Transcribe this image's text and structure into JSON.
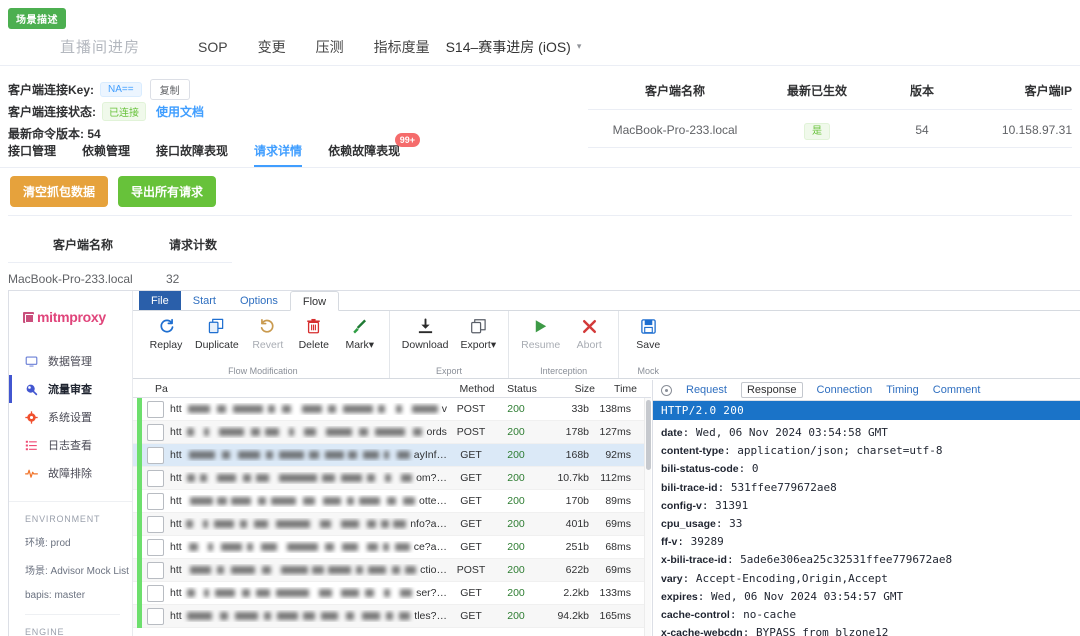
{
  "scenario_badge": "场景描述",
  "header": {
    "title": "直播间进房",
    "nav": [
      "SOP",
      "变更",
      "压测",
      "指标度量"
    ],
    "selector": "S14–赛事进房 (iOS)"
  },
  "client_info": {
    "key_label": "客户端连接Key:",
    "key_value": "NA==",
    "copy_button": "复制",
    "status_label": "客户端连接状态:",
    "status_value": "已连接",
    "doc_link": "使用文档",
    "version_label": "最新命令版本: 54"
  },
  "subtabs": [
    {
      "label": "接口管理",
      "active": false
    },
    {
      "label": "依赖管理",
      "active": false
    },
    {
      "label": "接口故障表现",
      "active": false
    },
    {
      "label": "请求详情",
      "active": true
    },
    {
      "label": "依赖故障表现",
      "active": false,
      "badge": "99+"
    }
  ],
  "actions": {
    "clear": "清空抓包数据",
    "export_all": "导出所有请求"
  },
  "left_table": {
    "headers": [
      "客户端名称",
      "请求计数"
    ],
    "rows": [
      [
        "MacBook-Pro-233.local",
        "32"
      ]
    ]
  },
  "right_table": {
    "headers": [
      "客户端名称",
      "最新已生效",
      "版本",
      "客户端IP"
    ],
    "rows": [
      [
        "MacBook-Pro-233.local",
        "是",
        "54",
        "10.158.97.31"
      ]
    ]
  },
  "mitm": {
    "logo": "mitmproxy",
    "nav": [
      {
        "label": "数据管理",
        "icon": "monitor-icon",
        "active": false
      },
      {
        "label": "流量审查",
        "icon": "inspect-icon",
        "active": true
      },
      {
        "label": "系统设置",
        "icon": "gear-icon",
        "active": false
      },
      {
        "label": "日志查看",
        "icon": "list-icon",
        "active": false
      },
      {
        "label": "故障排除",
        "icon": "pulse-icon",
        "active": false
      }
    ],
    "environment_header": "ENVIRONMENT",
    "environment": [
      "环境: prod",
      "场景: Advisor Mock List",
      "bapis: master"
    ],
    "engine_header": "ENGINE",
    "ribbon_tabs": [
      {
        "label": "File",
        "style": "file"
      },
      {
        "label": "Start",
        "style": "plain"
      },
      {
        "label": "Options",
        "style": "plain"
      },
      {
        "label": "Flow",
        "style": "active"
      }
    ],
    "ribbon_groups": [
      {
        "group_label": "Flow Modification",
        "items": [
          {
            "label": "Replay",
            "icon": "replay-icon",
            "disabled": false
          },
          {
            "label": "Duplicate",
            "icon": "duplicate-icon",
            "disabled": false
          },
          {
            "label": "Revert",
            "icon": "revert-icon",
            "disabled": true
          },
          {
            "label": "Delete",
            "icon": "trash-icon",
            "disabled": false
          },
          {
            "label": "Mark▾",
            "icon": "brush-icon",
            "disabled": false
          }
        ]
      },
      {
        "group_label": "Export",
        "items": [
          {
            "label": "Download",
            "icon": "download-icon",
            "disabled": false
          },
          {
            "label": "Export▾",
            "icon": "copy-icon",
            "disabled": false
          }
        ]
      },
      {
        "group_label": "Interception",
        "items": [
          {
            "label": "Resume",
            "icon": "play-icon",
            "disabled": true
          },
          {
            "label": "Abort",
            "icon": "cancel-icon",
            "disabled": true
          }
        ]
      },
      {
        "group_label": "Mock",
        "items": [
          {
            "label": "Save",
            "icon": "save-icon",
            "disabled": false
          }
        ]
      }
    ],
    "flow_headers": [
      "Pa",
      "Method",
      "Status",
      "Size",
      "Time"
    ],
    "flows": [
      {
        "prefix": "htt",
        "tail": "v",
        "method": "POST",
        "status": "200",
        "size": "33b",
        "time": "138ms",
        "selected": false
      },
      {
        "prefix": "htt",
        "tail": "ords",
        "method": "POST",
        "status": "200",
        "size": "178b",
        "time": "127ms",
        "selected": false
      },
      {
        "prefix": "htt",
        "tail": "ayInf…",
        "method": "GET",
        "status": "200",
        "size": "168b",
        "time": "92ms",
        "selected": true
      },
      {
        "prefix": "htt",
        "tail": "om?…",
        "method": "GET",
        "status": "200",
        "size": "10.7kb",
        "time": "112ms",
        "selected": false
      },
      {
        "prefix": "htt",
        "tail": "otte…",
        "method": "GET",
        "status": "200",
        "size": "170b",
        "time": "89ms",
        "selected": false
      },
      {
        "prefix": "htt",
        "tail": "nfo?a…",
        "method": "GET",
        "status": "200",
        "size": "401b",
        "time": "69ms",
        "selected": false
      },
      {
        "prefix": "htt",
        "tail": "ce?a…",
        "method": "GET",
        "status": "200",
        "size": "251b",
        "time": "68ms",
        "selected": false
      },
      {
        "prefix": "htt",
        "tail": "ctio…",
        "method": "POST",
        "status": "200",
        "size": "622b",
        "time": "69ms",
        "selected": false
      },
      {
        "prefix": "htt",
        "tail": "ser?…",
        "method": "GET",
        "status": "200",
        "size": "2.2kb",
        "time": "133ms",
        "selected": false
      },
      {
        "prefix": "htt",
        "tail": "tles?…",
        "method": "GET",
        "status": "200",
        "size": "94.2kb",
        "time": "165ms",
        "selected": false
      }
    ],
    "detail_tabs": [
      {
        "label": "Request",
        "active": false
      },
      {
        "label": "Response",
        "active": true
      },
      {
        "label": "Connection",
        "active": false
      },
      {
        "label": "Timing",
        "active": false
      },
      {
        "label": "Comment",
        "active": false
      }
    ],
    "status_line": "HTTP/2.0 200",
    "response_headers": [
      {
        "name": "date",
        "value": "Wed, 06 Nov 2024 03:54:58 GMT"
      },
      {
        "name": "content-type",
        "value": "application/json; charset=utf-8"
      },
      {
        "name": "bili-status-code",
        "value": "0"
      },
      {
        "name": "bili-trace-id",
        "value": "531ffee779672ae8"
      },
      {
        "name": "config-v",
        "value": "31391"
      },
      {
        "name": "cpu_usage",
        "value": "33"
      },
      {
        "name": "ff-v",
        "value": "39289"
      },
      {
        "name": "x-bili-trace-id",
        "value": "5ade6e306ea25c32531ffee779672ae8"
      },
      {
        "name": "vary",
        "value": "Accept-Encoding,Origin,Accept"
      },
      {
        "name": "expires",
        "value": "Wed, 06 Nov 2024 03:54:57 GMT"
      },
      {
        "name": "cache-control",
        "value": "no-cache"
      },
      {
        "name": "x-cache-webcdn",
        "value": "BYPASS from blzone12"
      }
    ]
  }
}
